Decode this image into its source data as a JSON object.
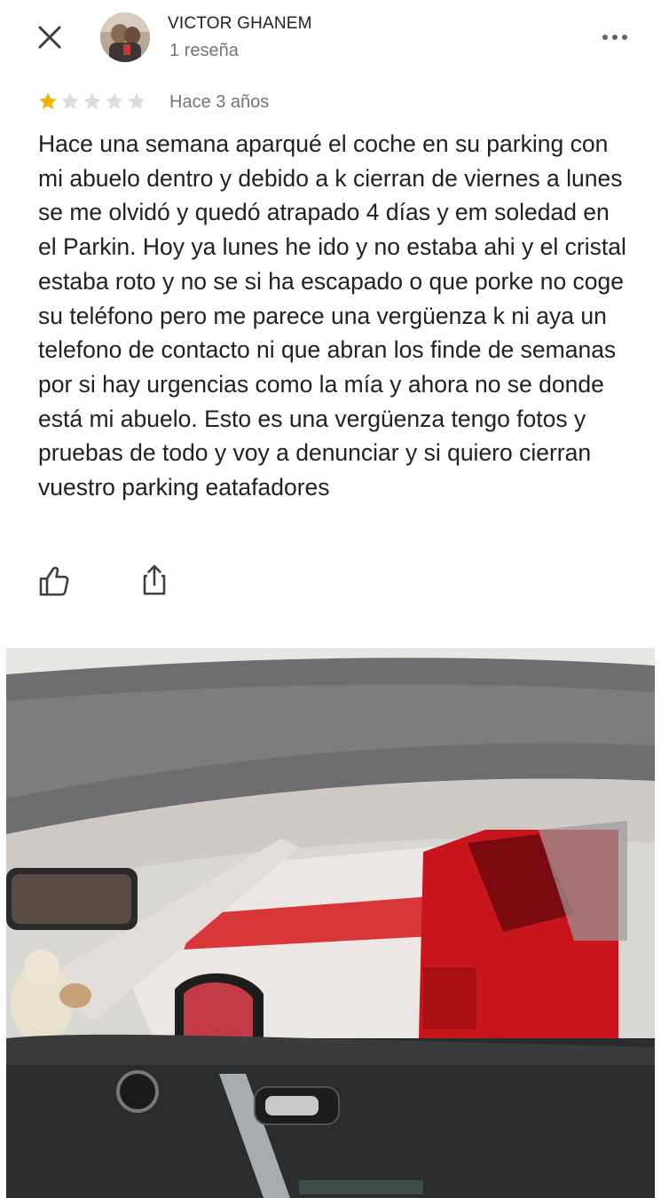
{
  "review": {
    "author_name": "VICTOR GHANEM",
    "author_review_count": "1 reseña",
    "rating": 1,
    "rating_max": 5,
    "time_ago": "Hace 3 años",
    "text": "Hace una semana aparqué el coche en su parking con mi abuelo dentro y debido a k cierran de viernes a lunes se me olvidó y quedó atrapado 4 días y em soledad en el Parkin. Hoy ya lunes he ido y no estaba ahi y el cristal estaba roto y no se si ha escapado o que porke no coge su teléfono pero me parece una vergüenza k ni aya un telefono de contacto ni que abran los finde de semanas por si hay urgencias como la mía y ahora no se donde está mi abuelo. Esto es una vergüenza tengo fotos y pruebas de todo y voy a denunciar y si quiero cierran vuestro parking eatafadores"
  },
  "icons": {
    "close": "close-icon",
    "more": "more-vertical-dots-icon",
    "like": "thumbs-up-icon",
    "share": "share-icon",
    "star_filled": "star-filled-icon",
    "star_empty": "star-empty-icon"
  },
  "colors": {
    "star_filled": "#f4b400",
    "star_empty": "#dadce0",
    "text_primary": "#202124",
    "text_secondary": "#70757a"
  }
}
